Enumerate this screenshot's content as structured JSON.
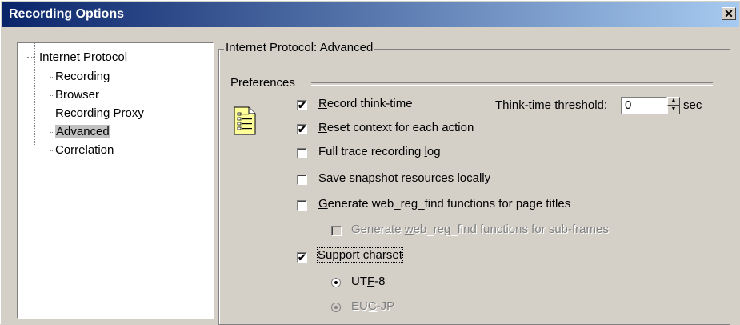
{
  "window": {
    "title": "Recording Options",
    "close_symbol": "✕"
  },
  "tree": {
    "items": [
      {
        "label": "Internet Protocol"
      },
      {
        "label": "Recording"
      },
      {
        "label": "Browser"
      },
      {
        "label": "Recording Proxy"
      },
      {
        "label": "Advanced",
        "selected": true
      },
      {
        "label": "Correlation"
      }
    ]
  },
  "panel": {
    "group_title": "Internet Protocol: Advanced",
    "preferences_label": "Preferences",
    "options": {
      "think_time": {
        "pre": "",
        "u": "R",
        "post": "ecord think-time",
        "checked": true
      },
      "reset_context": {
        "pre": "",
        "u": "R",
        "post": "eset context for each action",
        "checked": true
      },
      "full_trace": {
        "pre": "Full trace recording ",
        "u": "l",
        "post": "og",
        "checked": false
      },
      "save_snapshot": {
        "pre": "",
        "u": "S",
        "post": "ave snapshot resources locally",
        "checked": false
      },
      "gen_web_reg": {
        "pre": "",
        "u": "G",
        "post": "enerate web_reg_find functions for page titles",
        "checked": false
      },
      "gen_subframes": {
        "pre": "Generate ",
        "u": "w",
        "post": "eb_reg_find functions for sub-frames",
        "checked": false,
        "disabled": true
      },
      "support_charset": {
        "pre": "Support charset",
        "u": "",
        "post": "",
        "checked": true
      }
    },
    "threshold": {
      "pre": "",
      "u": "T",
      "post": "hink-time threshold:",
      "value": "0",
      "unit": "sec"
    },
    "charsets": [
      {
        "pre": "UT",
        "u": "F",
        "post": "-8",
        "selected": true,
        "disabled": false
      },
      {
        "pre": "EU",
        "u": "C",
        "post": "-JP",
        "selected": true,
        "disabled": true
      }
    ],
    "check_mark": "✔",
    "spin_up": "▲",
    "spin_down": "▼"
  }
}
